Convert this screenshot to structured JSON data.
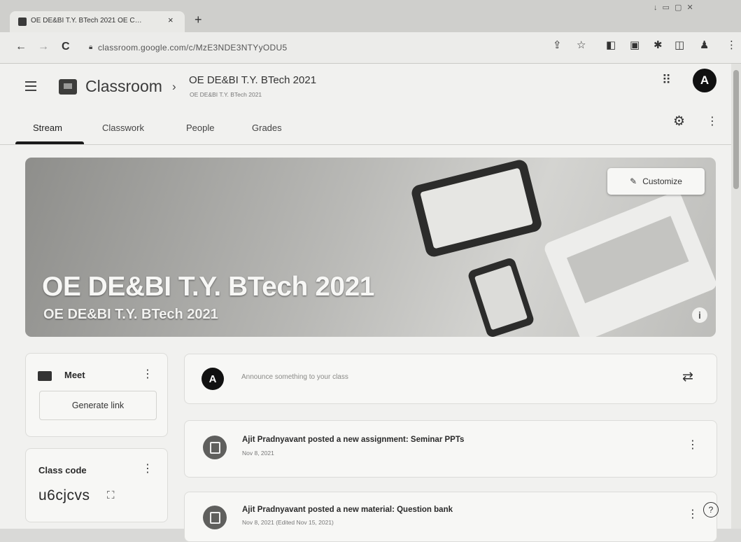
{
  "browser": {
    "tab_title": "OE DE&BI T.Y. BTech 2021 OE C…",
    "tab_close": "×",
    "new_tab": "+",
    "window_controls": "↓ ▭ ▢ ✕",
    "nav_back": "←",
    "nav_forward": "→",
    "nav_reload": "C",
    "url": "classroom.google.com/c/MzE3NDE3NTYyODU5",
    "toolbar_icons": [
      "share-icon",
      "star-icon",
      "extension-icon",
      "tab-search-icon",
      "pin-icon",
      "sidepanel-icon",
      "profile-icon",
      "menu-icon"
    ]
  },
  "header": {
    "app_name": "Classroom",
    "crumb_separator": "›",
    "class_title": "OE DE&BI T.Y. BTech 2021",
    "class_subtitle": "OE DE&BI T.Y. BTech 2021",
    "apps_glyph": "⠿",
    "avatar_initial": "A"
  },
  "tabs": [
    {
      "label": "Stream",
      "active": true
    },
    {
      "label": "Classwork",
      "active": false
    },
    {
      "label": "People",
      "active": false
    },
    {
      "label": "Grades",
      "active": false
    }
  ],
  "banner": {
    "title": "OE DE&BI T.Y. BTech 2021",
    "subtitle": "OE DE&BI T.Y. BTech 2021",
    "customize_label": "Customize",
    "info_glyph": "i"
  },
  "meet": {
    "label": "Meet",
    "generate_link": "Generate link"
  },
  "class_code": {
    "label": "Class code",
    "value": "u6cjcvs"
  },
  "announce": {
    "avatar_initial": "A",
    "placeholder": "Announce something to your class"
  },
  "posts": [
    {
      "title": "Ajit Pradnyavant posted a new assignment: Seminar PPTs",
      "date": "Nov 8, 2021"
    },
    {
      "title": "Ajit Pradnyavant posted a new material: Question bank",
      "date": "Nov 8, 2021 (Edited Nov 15, 2021)"
    }
  ],
  "colors": {
    "accent": "#1b1b1b",
    "page_bg": "#f1f1ef",
    "card_bg": "#f7f7f5"
  }
}
